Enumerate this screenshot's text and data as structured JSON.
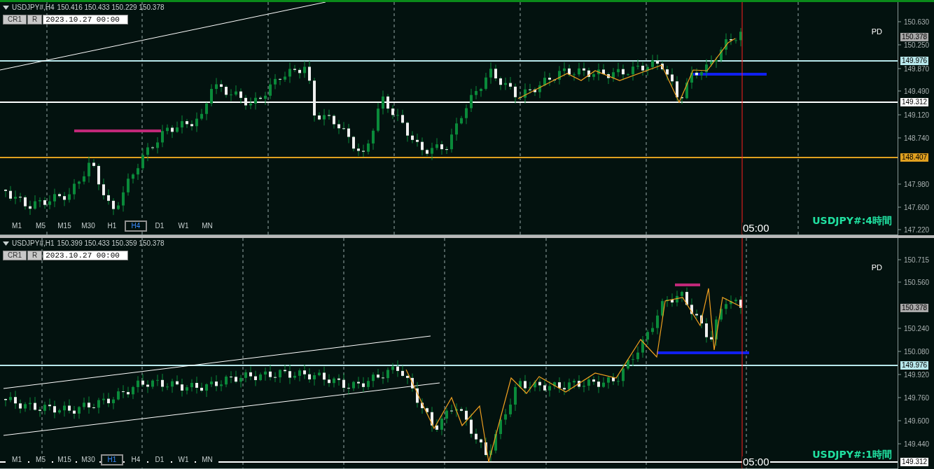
{
  "panes": [
    {
      "symbol": "USDJPY#,H4",
      "quote": "150.416 150.433 150.229 150.378",
      "buttons": [
        "CR1",
        "R"
      ],
      "date": "2023.10.27 00:00",
      "pd_label": "PD",
      "timeframes": [
        {
          "label": "M1",
          "selected": false
        },
        {
          "label": "M5",
          "selected": false
        },
        {
          "label": "M15",
          "selected": false
        },
        {
          "label": "M30",
          "selected": false
        },
        {
          "label": "H1",
          "selected": false
        },
        {
          "label": "H4",
          "selected": true
        },
        {
          "label": "D1",
          "selected": false
        },
        {
          "label": "W1",
          "selected": false
        },
        {
          "label": "MN",
          "selected": false
        }
      ],
      "title": "USDJPY#:4時間",
      "time_label": "05:00",
      "axis_ticks": [
        "150.630",
        "150.250",
        "149.870",
        "149.490",
        "149.120",
        "148.740",
        "147.980",
        "147.600",
        "147.220"
      ],
      "price_tags": [
        {
          "label": "150.378",
          "color": "#a8a8a8",
          "line": false
        },
        {
          "label": "149.976",
          "color": "#b8e8ec",
          "line": true
        },
        {
          "label": "149.312",
          "color": "#ffffff",
          "line": true
        },
        {
          "label": "148.407",
          "color": "#e0a020",
          "line": true
        }
      ]
    },
    {
      "symbol": "USDJPY#,H1",
      "quote": "150.399 150.433 150.359 150.378",
      "buttons": [
        "CR1",
        "R"
      ],
      "date": "2023.10.27 00:00",
      "pd_label": "PD",
      "timeframes": [
        {
          "label": "M1",
          "selected": false
        },
        {
          "label": "M5",
          "selected": false
        },
        {
          "label": "M15",
          "selected": false
        },
        {
          "label": "M30",
          "selected": false
        },
        {
          "label": "H1",
          "selected": true
        },
        {
          "label": "H4",
          "selected": false
        },
        {
          "label": "D1",
          "selected": false
        },
        {
          "label": "W1",
          "selected": false
        },
        {
          "label": "MN",
          "selected": false
        }
      ],
      "title": "USDJPY#:1時間",
      "time_label": "05:00",
      "axis_ticks": [
        "150.715",
        "150.560",
        "150.240",
        "150.080",
        "149.920",
        "149.760",
        "149.600",
        "149.440"
      ],
      "price_tags": [
        {
          "label": "150.378",
          "color": "#a8a8a8",
          "line": false
        },
        {
          "label": "149.976",
          "color": "#b8e8ec",
          "line": true
        },
        {
          "label": "149.312",
          "color": "#ffffff",
          "line": true
        }
      ]
    }
  ]
}
